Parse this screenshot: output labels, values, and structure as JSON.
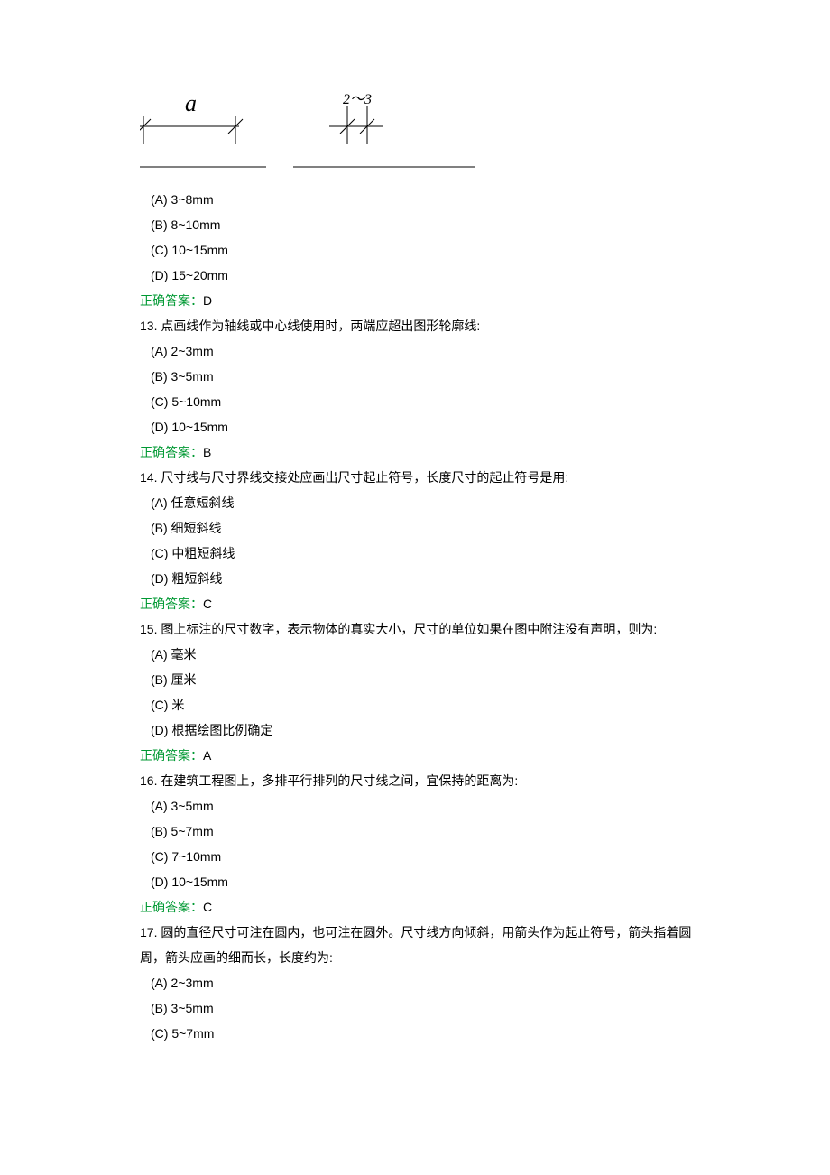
{
  "diagram": {
    "label_a": "a",
    "label_right": "2～3"
  },
  "q12": {
    "options": {
      "a": "(A) 3~8mm",
      "b": "(B) 8~10mm",
      "c": "(C) 10~15mm",
      "d": "(D) 15~20mm"
    },
    "answer_label": "正确答案：",
    "answer": "D"
  },
  "q13": {
    "number": "13.",
    "text": "点画线作为轴线或中心线使用时，两端应超出图形轮廓线:",
    "options": {
      "a": "(A) 2~3mm",
      "b": "(B) 3~5mm",
      "c": "(C) 5~10mm",
      "d": "(D) 10~15mm"
    },
    "answer_label": "正确答案：",
    "answer": "B"
  },
  "q14": {
    "number": "14.",
    "text": "尺寸线与尺寸界线交接处应画出尺寸起止符号，长度尺寸的起止符号是用:",
    "options": {
      "a": "(A) 任意短斜线",
      "b": "(B) 细短斜线",
      "c": "(C) 中粗短斜线",
      "d": "(D) 粗短斜线"
    },
    "answer_label": "正确答案：",
    "answer": "C"
  },
  "q15": {
    "number": "15.",
    "text": "图上标注的尺寸数字，表示物体的真实大小，尺寸的单位如果在图中附注没有声明，则为:",
    "options": {
      "a": "(A) 毫米",
      "b": "(B) 厘米",
      "c": "(C) 米",
      "d": "(D) 根据绘图比例确定"
    },
    "answer_label": "正确答案：",
    "answer": "A"
  },
  "q16": {
    "number": "16.",
    "text": "在建筑工程图上，多排平行排列的尺寸线之间，宜保持的距离为:",
    "options": {
      "a": "(A) 3~5mm",
      "b": "(B) 5~7mm",
      "c": "(C) 7~10mm",
      "d": "(D) 10~15mm"
    },
    "answer_label": "正确答案：",
    "answer": "C"
  },
  "q17": {
    "number": "17.",
    "text": "圆的直径尺寸可注在圆内，也可注在圆外。尺寸线方向倾斜，用箭头作为起止符号，箭头指着圆周，箭头应画的细而长，长度约为:",
    "options": {
      "a": "(A) 2~3mm",
      "b": "(B) 3~5mm",
      "c": "(C) 5~7mm"
    }
  }
}
